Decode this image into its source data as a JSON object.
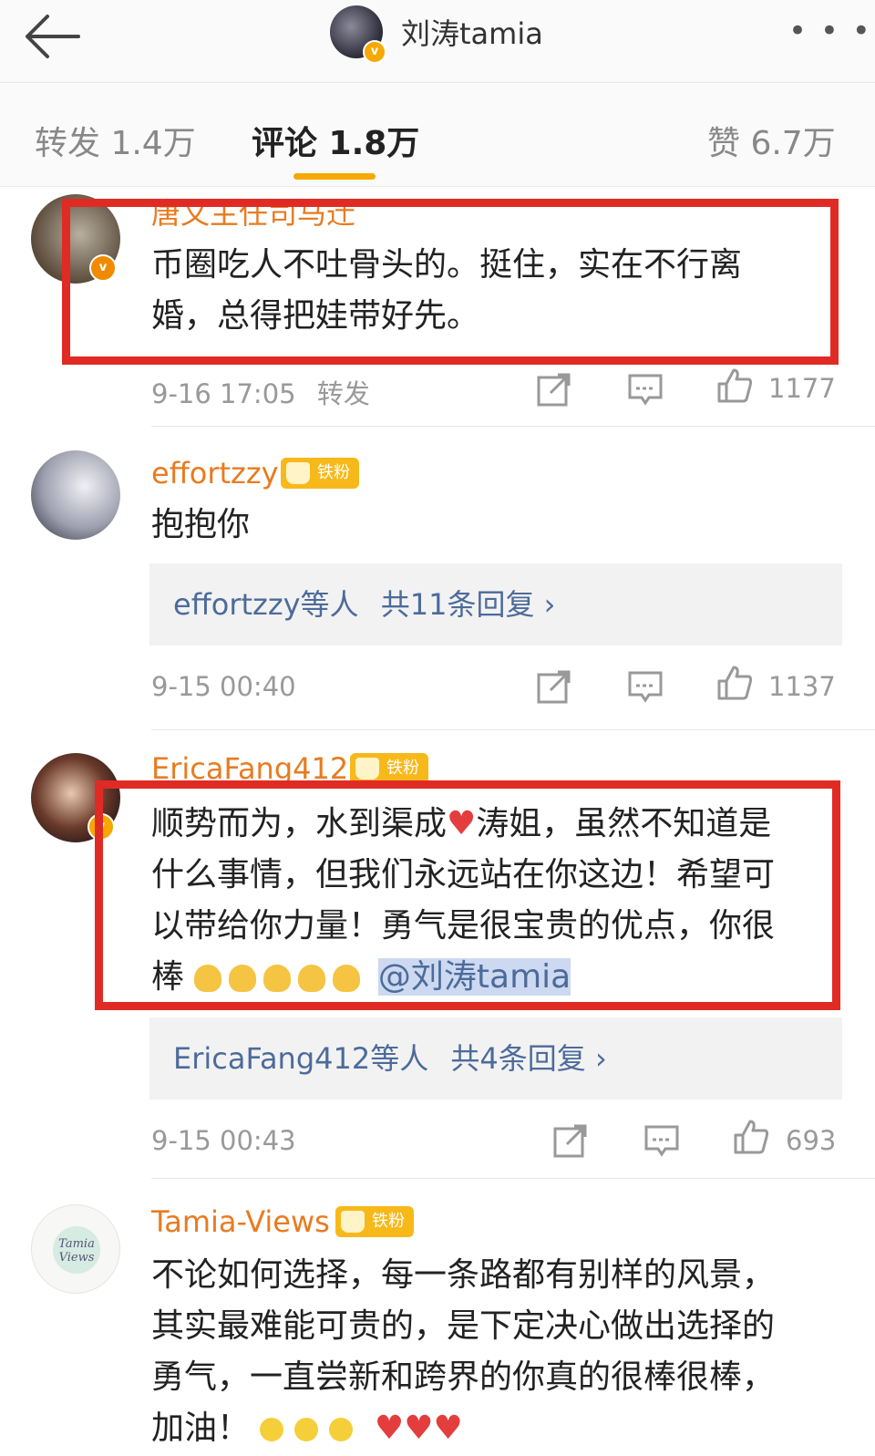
{
  "header": {
    "title": "刘涛tamia",
    "more": "• • •"
  },
  "tabs": {
    "repost": "转发 1.4万",
    "comment": "评论 1.8万",
    "like": "赞 6.7万"
  },
  "comments": [
    {
      "name": "唐文主任司马迁",
      "text_lines": [
        "币圈吃人不吐骨头的。挺住，实在不行离",
        "婚，总得把娃带好先。"
      ],
      "time": "9-16 17:05",
      "repost_label": "转发",
      "likes": "1177"
    },
    {
      "name": "effortzzy",
      "badge": "铁粉",
      "text_lines": [
        "抱抱你"
      ],
      "reply_users": "effortzzy等人",
      "reply_count": "共11条回复 ›",
      "time": "9-15 00:40",
      "likes": "1137"
    },
    {
      "name": "EricaFang412",
      "badge": "铁粉",
      "text_lines": [
        "顺势而为，水到渠成",
        "涛姐，虽然不知道是",
        "什么事情，但我们永远站在你这边！希望可",
        "以带给你力量！勇气是很宝贵的优点，你很",
        "棒"
      ],
      "mention": "@刘涛tamia",
      "reply_users": "EricaFang412等人",
      "reply_count": "共4条回复 ›",
      "time": "9-15 00:43",
      "likes": "693"
    },
    {
      "name": "Tamia-Views",
      "badge": "铁粉",
      "avatar_text": "Tamia Views",
      "text_lines": [
        "不论如何选择，每一条路都有别样的风景，",
        "其实最难能可贵的，是下定决心做出选择的",
        "勇气，一直尝新和跨界的你真的很棒很棒，",
        "加油！"
      ]
    }
  ],
  "colors": {
    "accent": "#f7a800",
    "username": "#e87b20",
    "link": "#4c6b9b",
    "highlight_box": "#e02b25"
  },
  "icons": [
    "back-arrow-icon",
    "more-icon",
    "share-icon",
    "comment-icon",
    "like-icon",
    "verified-icon",
    "crown-icon"
  ]
}
